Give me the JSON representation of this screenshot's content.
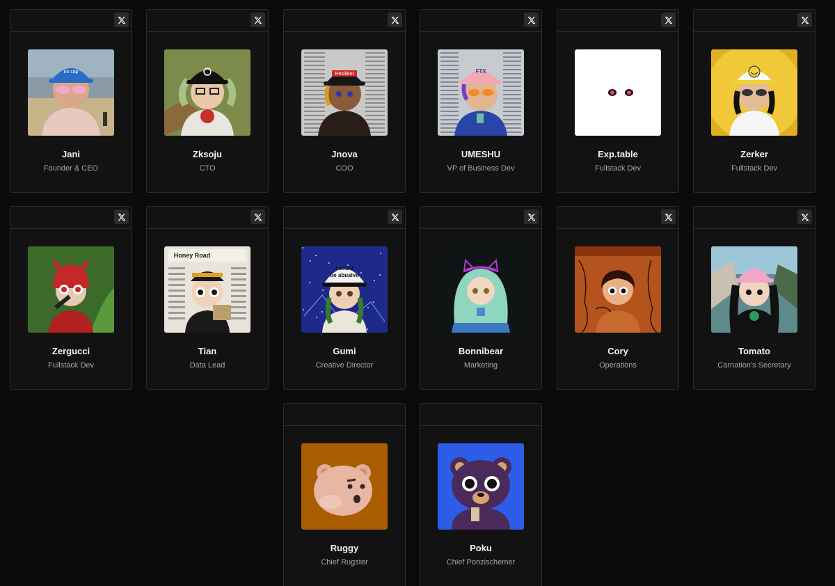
{
  "team": [
    {
      "name": "Jani",
      "role": "Founder & CEO",
      "avatar": "avatar-blue-cap-beach",
      "bg": "#8a9aa6",
      "x_link": true
    },
    {
      "name": "Zksoju",
      "role": "CTO",
      "avatar": "avatar-black-cap-forest",
      "bg": "#6a7a4a",
      "x_link": true
    },
    {
      "name": "Jnova",
      "role": "COO",
      "avatar": "avatar-resilient-cap",
      "bg": "#c9c9c9",
      "x_link": true
    },
    {
      "name": "UMESHU",
      "role": "VP of Business Dev",
      "avatar": "avatar-ftx-pink-cap",
      "bg": "#c7cbd0",
      "x_link": true
    },
    {
      "name": "Exp.table",
      "role": "Fullstack Dev",
      "avatar": "avatar-floating-eyes",
      "bg": "#ffffff",
      "x_link": true
    },
    {
      "name": "Zerker",
      "role": "Fullstack Dev",
      "avatar": "avatar-smiley-cap",
      "bg": "#e0b020",
      "x_link": true
    },
    {
      "name": "Zergucci",
      "role": "Fullstack Dev",
      "avatar": "avatar-red-devil",
      "bg": "#3f6a2a",
      "x_link": true
    },
    {
      "name": "Tian",
      "role": "Data Lead",
      "avatar": "avatar-honey-road",
      "bg": "#e8e4da",
      "x_link": true
    },
    {
      "name": "Gumi",
      "role": "Creative Director",
      "avatar": "avatar-could-be-abusive",
      "bg": "#1d2a8a",
      "x_link": true
    },
    {
      "name": "Bonnibear",
      "role": "Marketing",
      "avatar": "avatar-cat-ears-teal",
      "bg": "#0f1414",
      "x_link": true
    },
    {
      "name": "Cory",
      "role": "Operations",
      "avatar": "avatar-orange-fresco",
      "bg": "#b5531e",
      "x_link": true
    },
    {
      "name": "Tomato",
      "role": "Carnation's Secretary",
      "avatar": "avatar-pink-cap-city",
      "bg": "#5f8a8c",
      "x_link": true
    },
    {
      "name": "Ruggy",
      "role": "Chief Rugster",
      "avatar": "avatar-bear-orange",
      "bg": "#a85d00",
      "x_link": false
    },
    {
      "name": "Poku",
      "role": "Chief Ponzischemer",
      "avatar": "avatar-bear-blue",
      "bg": "#2d5ce6",
      "x_link": false
    }
  ],
  "avatar_text": {
    "no_cap": "no cap",
    "resilient": "Resilient",
    "ftx": "FTX",
    "honey_road": "Honey Road",
    "could_be": "I could",
    "be_abusive": "be abusive"
  }
}
